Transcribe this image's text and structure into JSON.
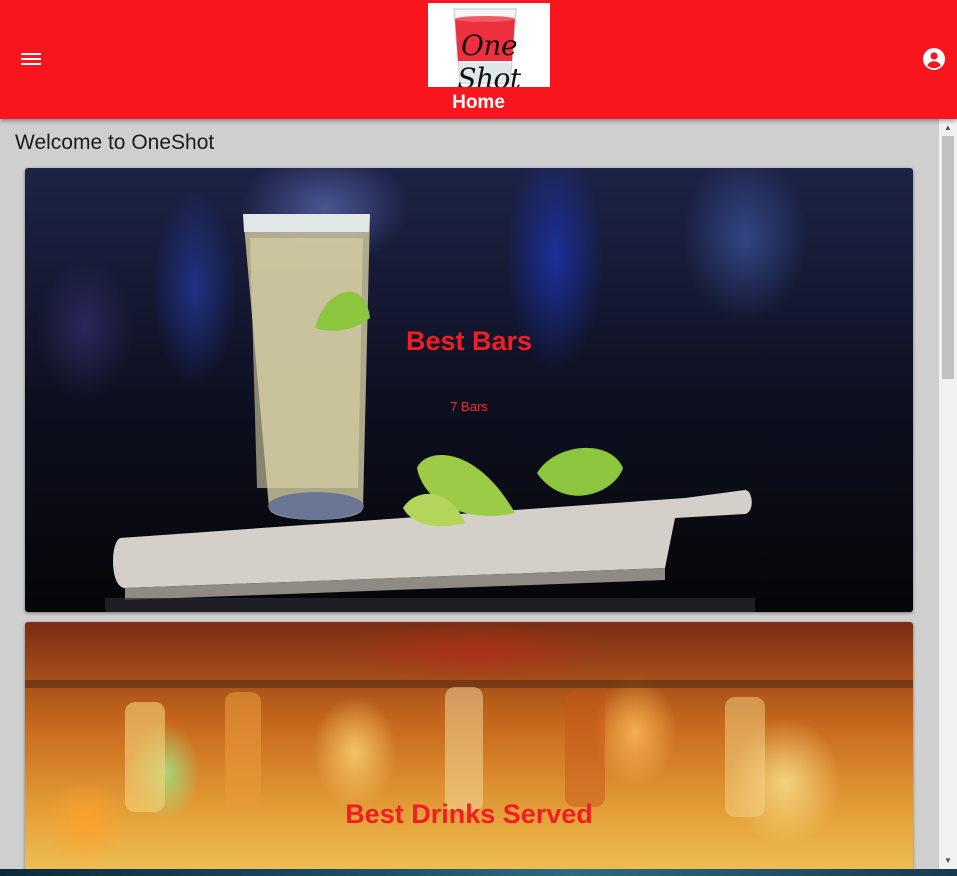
{
  "header": {
    "logo_text": "One Shot",
    "title": "Home",
    "background_color": "#f8151d",
    "menu_icon": "menu-icon",
    "account_icon": "account-circle-icon"
  },
  "main": {
    "welcome": "Welcome to OneShot",
    "cards": [
      {
        "title": "Best Bars",
        "subtitle": "7 Bars"
      },
      {
        "title": "Best Drinks Served"
      }
    ]
  },
  "colors": {
    "accent": "#ef1e24",
    "page_background": "#cfcfcf"
  }
}
